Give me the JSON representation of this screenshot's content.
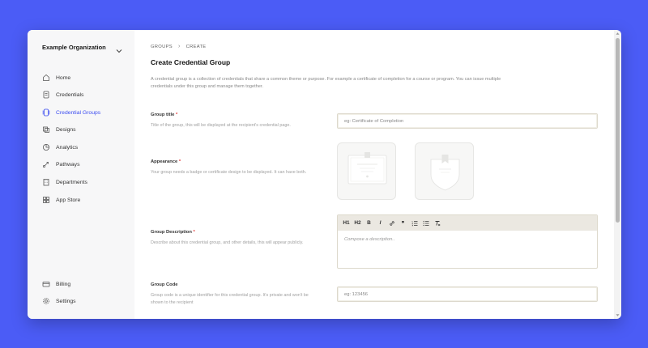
{
  "sidebar": {
    "org_name": "Example Organization",
    "items": [
      {
        "label": "Home",
        "icon": "home-icon"
      },
      {
        "label": "Credentials",
        "icon": "credential-icon"
      },
      {
        "label": "Credential Groups",
        "icon": "group-icon",
        "active": true
      },
      {
        "label": "Designs",
        "icon": "designs-icon"
      },
      {
        "label": "Analytics",
        "icon": "analytics-icon"
      },
      {
        "label": "Pathways",
        "icon": "pathways-icon"
      },
      {
        "label": "Departments",
        "icon": "departments-icon"
      },
      {
        "label": "App Store",
        "icon": "app-store-icon"
      }
    ],
    "bottom_items": [
      {
        "label": "Billing",
        "icon": "billing-icon"
      },
      {
        "label": "Settings",
        "icon": "settings-icon"
      }
    ]
  },
  "breadcrumb": {
    "first": "GROUPS",
    "second": "CREATE"
  },
  "page": {
    "title": "Create Credential Group",
    "intro": "A credential group is a collection of credentials that share a common theme or purpose. For example a certificate of completion for a course or program. You can issue multiple credentials under this group and manage them together."
  },
  "fields": {
    "title": {
      "label": "Group title",
      "help": "Title of the group, this will be displayed at the recipient's credential page.",
      "placeholder": "eg: Certificate of Completion"
    },
    "appearance": {
      "label": "Appearance",
      "help": "Your group needs a badge or certificate design to be displayed. It can have both."
    },
    "description": {
      "label": "Group Description",
      "help": "Describe about this credential group, and other details, this will appear publicly.",
      "placeholder": "Compose a description..",
      "toolbar": [
        "H1",
        "H2",
        "B",
        "I",
        "link",
        "quote",
        "ol",
        "ul",
        "clear"
      ]
    },
    "code": {
      "label": "Group Code",
      "help": "Group code is a unique identifier for this credential group. It's private and won't be shown to the recipient",
      "placeholder": "eg: 123456"
    },
    "required_mark": "*"
  },
  "colors": {
    "accent": "#3b4cf0",
    "background": "#4b5cf6",
    "required": "#e23b3b"
  }
}
